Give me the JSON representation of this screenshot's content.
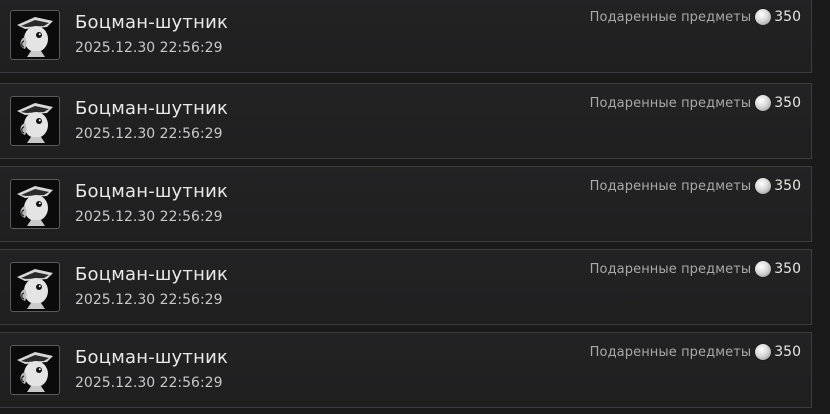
{
  "entries": [
    {
      "name": "Боцман-шутник",
      "datetime": "2025.12.30 22:56:29",
      "gift_label": "Подаренные предметы",
      "amount": "350",
      "avatar_icon": "pirate-parrot-icon",
      "coin_icon": "silver-coin-icon"
    },
    {
      "name": "Боцман-шутник",
      "datetime": "2025.12.30 22:56:29",
      "gift_label": "Подаренные предметы",
      "amount": "350",
      "avatar_icon": "pirate-parrot-icon",
      "coin_icon": "silver-coin-icon"
    },
    {
      "name": "Боцман-шутник",
      "datetime": "2025.12.30 22:56:29",
      "gift_label": "Подаренные предметы",
      "amount": "350",
      "avatar_icon": "pirate-parrot-icon",
      "coin_icon": "silver-coin-icon"
    },
    {
      "name": "Боцман-шутник",
      "datetime": "2025.12.30 22:56:29",
      "gift_label": "Подаренные предметы",
      "amount": "350",
      "avatar_icon": "pirate-parrot-icon",
      "coin_icon": "silver-coin-icon"
    },
    {
      "name": "Боцман-шутник",
      "datetime": "2025.12.30 22:56:29",
      "gift_label": "Подаренные предметы",
      "amount": "350",
      "avatar_icon": "pirate-parrot-icon",
      "coin_icon": "silver-coin-icon"
    }
  ],
  "colors": {
    "background": "#1a1a1b",
    "row_border": "#3b3d40",
    "name_text": "#e9e9e9",
    "label_text": "#a9a9a9"
  }
}
